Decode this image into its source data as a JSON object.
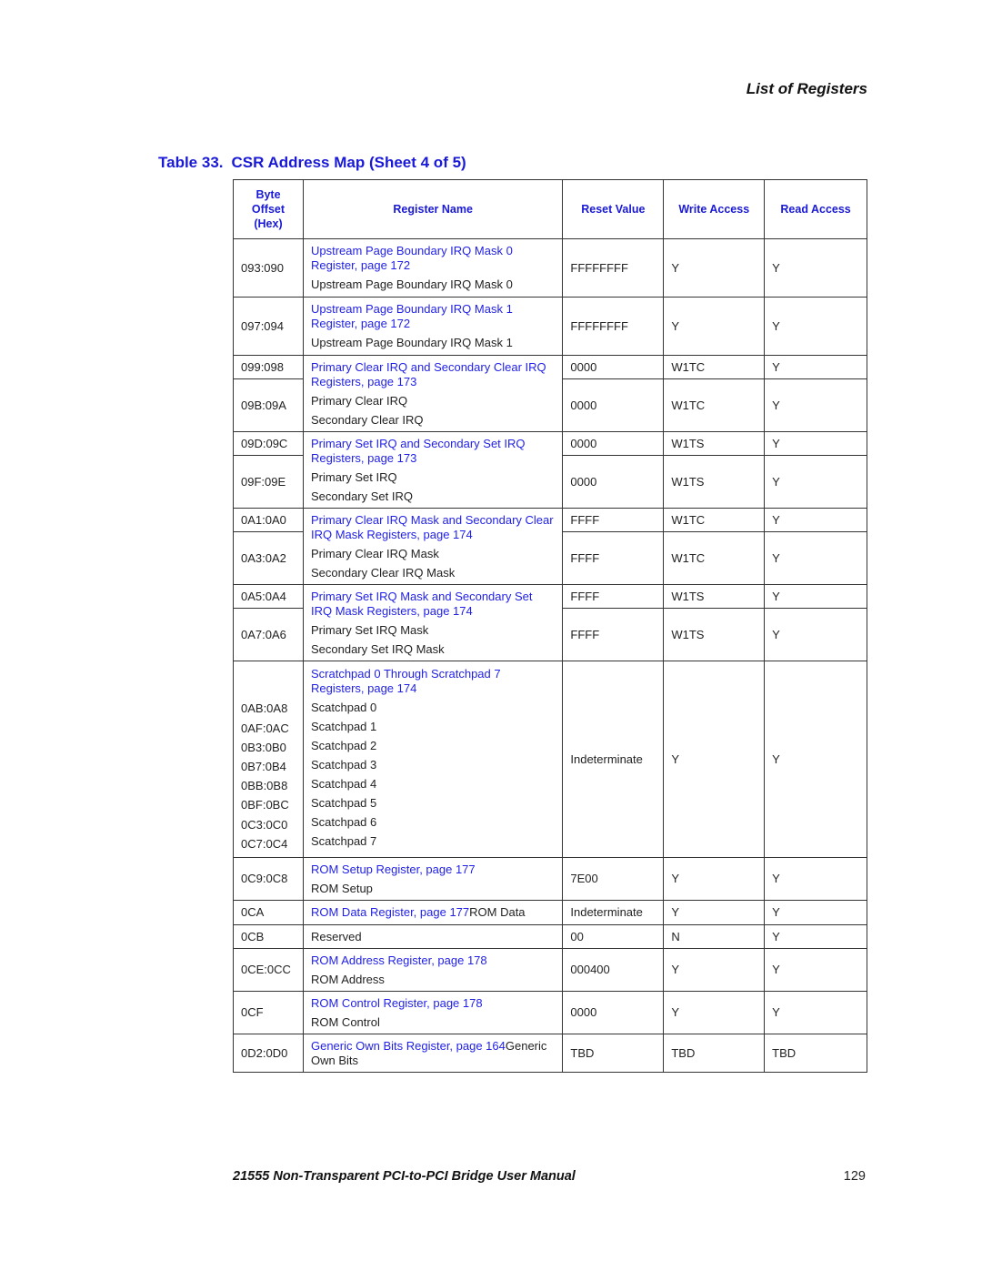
{
  "running_head": "List of Registers",
  "caption": {
    "number": "Table 33.",
    "title": "CSR Address Map  (Sheet 4 of 5)"
  },
  "columns": [
    "Byte Offset (Hex)",
    "Register Name",
    "Reset Value",
    "Write Access",
    "Read Access"
  ],
  "column_lines": [
    "Byte",
    "Offset",
    "(Hex)"
  ],
  "rows": {
    "r1": {
      "offset": "093:090",
      "link": "Upstream Page Boundary IRQ Mask 0 Register, page 172",
      "name": "Upstream Page Boundary IRQ Mask 0",
      "reset": "FFFFFFFF",
      "write": "Y",
      "read": "Y"
    },
    "r2": {
      "offset": "097:094",
      "link": "Upstream Page Boundary IRQ Mask 1 Register, page 172",
      "name": "Upstream Page Boundary IRQ Mask 1",
      "reset": "FFFFFFFF",
      "write": "Y",
      "read": "Y"
    },
    "r3": {
      "link": "Primary Clear IRQ and Secondary Clear IRQ Registers, page 173",
      "names": [
        "Primary Clear IRQ",
        "Secondary Clear IRQ"
      ],
      "a": {
        "offset": "099:098",
        "reset": "0000",
        "write": "W1TC",
        "read": "Y"
      },
      "b": {
        "offset": "09B:09A",
        "reset": "0000",
        "write": "W1TC",
        "read": "Y"
      }
    },
    "r4": {
      "link": "Primary Set IRQ and Secondary Set IRQ Registers, page 173",
      "names": [
        "Primary Set IRQ",
        "Secondary Set IRQ"
      ],
      "a": {
        "offset": "09D:09C",
        "reset": "0000",
        "write": "W1TS",
        "read": "Y"
      },
      "b": {
        "offset": "09F:09E",
        "reset": "0000",
        "write": "W1TS",
        "read": "Y"
      }
    },
    "r5": {
      "link": "Primary Clear IRQ Mask and Secondary Clear IRQ Mask Registers, page 174",
      "names": [
        "Primary Clear IRQ Mask",
        "Secondary Clear IRQ Mask"
      ],
      "a": {
        "offset": "0A1:0A0",
        "reset": "FFFF",
        "write": "W1TC",
        "read": "Y"
      },
      "b": {
        "offset": "0A3:0A2",
        "reset": "FFFF",
        "write": "W1TC",
        "read": "Y"
      }
    },
    "r6": {
      "link": "Primary Set IRQ Mask and Secondary Set IRQ Mask Registers, page 174",
      "names": [
        "Primary Set IRQ Mask",
        "Secondary Set IRQ Mask"
      ],
      "a": {
        "offset": "0A5:0A4",
        "reset": "FFFF",
        "write": "W1TS",
        "read": "Y"
      },
      "b": {
        "offset": "0A7:0A6",
        "reset": "FFFF",
        "write": "W1TS",
        "read": "Y"
      }
    },
    "r7": {
      "link": "Scratchpad 0 Through Scratchpad 7 Registers, page 174",
      "offsets": [
        "0AB:0A8",
        "0AF:0AC",
        "0B3:0B0",
        "0B7:0B4",
        "0BB:0B8",
        "0BF:0BC",
        "0C3:0C0",
        "0C7:0C4"
      ],
      "names": [
        "Scatchpad 0",
        "Scatchpad 1",
        "Scatchpad 2",
        "Scatchpad 3",
        "Scatchpad 4",
        "Scatchpad 5",
        "Scatchpad 6",
        "Scatchpad 7"
      ],
      "reset": "Indeterminate",
      "write": "Y",
      "read": "Y"
    },
    "r8": {
      "offset": "0C9:0C8",
      "link": "ROM Setup Register, page 177",
      "name": "ROM Setup",
      "reset": "7E00",
      "write": "Y",
      "read": "Y"
    },
    "r9": {
      "offset": "0CA",
      "link": "ROM Data Register, page 177",
      "name": "ROM Data",
      "reset": "Indeterminate",
      "write": "Y",
      "read": "Y"
    },
    "r10": {
      "offset": "0CB",
      "name": "Reserved",
      "reset": "00",
      "write": "N",
      "read": "Y"
    },
    "r11": {
      "offset": "0CE:0CC",
      "link": "ROM Address Register, page 178",
      "name": "ROM Address",
      "reset": "000400",
      "write": "Y",
      "read": "Y"
    },
    "r12": {
      "offset": "0CF",
      "link": "ROM Control Register, page 178",
      "name": "ROM Control",
      "reset": "0000",
      "write": "Y",
      "read": "Y"
    },
    "r13": {
      "offset": "0D2:0D0",
      "link": "Generic Own Bits Register, page 164",
      "name": "Generic Own Bits",
      "reset": "TBD",
      "write": "TBD",
      "read": "TBD"
    }
  },
  "footer": {
    "title": "21555 Non-Transparent PCI-to-PCI Bridge User Manual",
    "page": "129"
  },
  "colors": {
    "heading_blue": "#1a1ad6",
    "link_blue": "#1f1fe8"
  }
}
